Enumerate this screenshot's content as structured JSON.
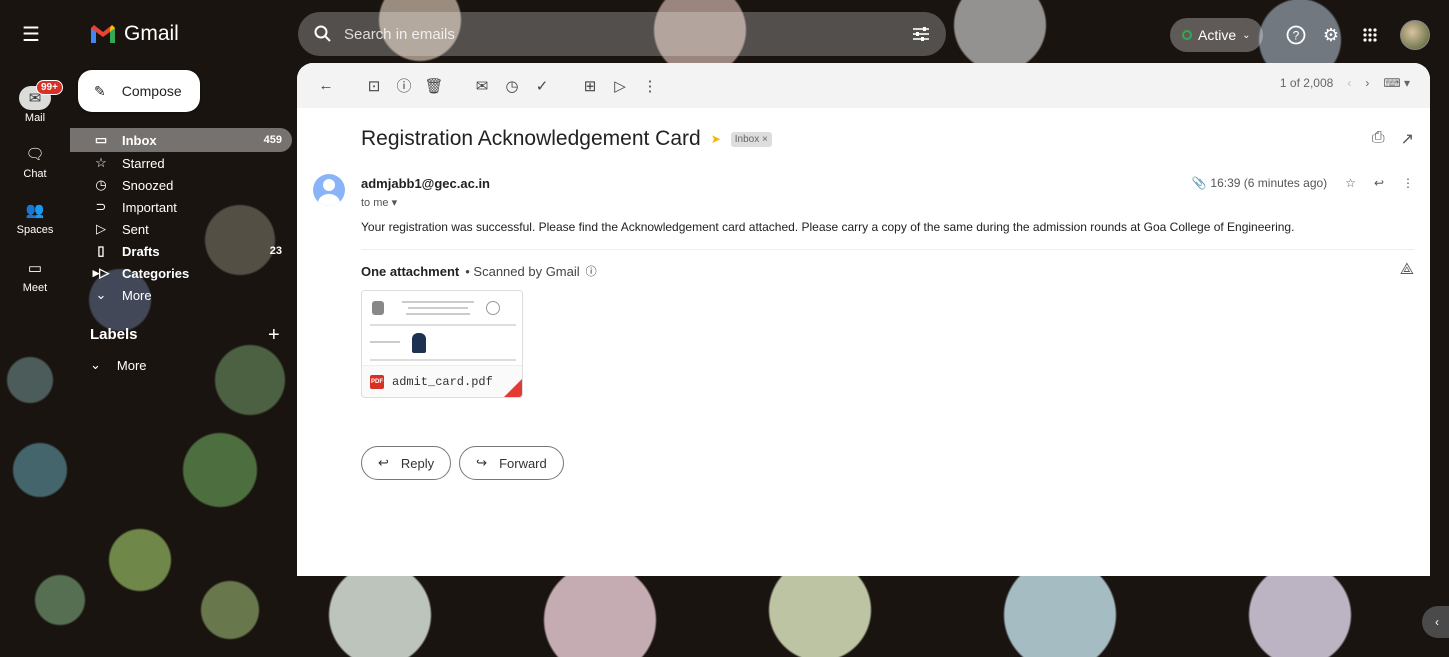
{
  "app": {
    "name": "Gmail"
  },
  "rail": {
    "mail_badge": "99+",
    "items": [
      {
        "label": "Mail",
        "icon": "mail-icon"
      },
      {
        "label": "Chat",
        "icon": "chat-icon"
      },
      {
        "label": "Spaces",
        "icon": "spaces-icon"
      },
      {
        "label": "Meet",
        "icon": "meet-icon"
      }
    ]
  },
  "search": {
    "placeholder": "Search in emails"
  },
  "status": {
    "label": "Active",
    "color": "#34a853"
  },
  "compose": {
    "label": "Compose"
  },
  "nav": [
    {
      "label": "Inbox",
      "count": "459",
      "icon": "inbox-icon"
    },
    {
      "label": "Starred",
      "count": "",
      "icon": "star-icon"
    },
    {
      "label": "Snoozed",
      "count": "",
      "icon": "clock-icon"
    },
    {
      "label": "Important",
      "count": "",
      "icon": "important-icon"
    },
    {
      "label": "Sent",
      "count": "",
      "icon": "send-icon"
    },
    {
      "label": "Drafts",
      "count": "23",
      "icon": "draft-icon"
    },
    {
      "label": "Categories",
      "count": "",
      "icon": "label-icon"
    },
    {
      "label": "More",
      "count": "",
      "icon": "chevron-down-icon"
    }
  ],
  "labels": {
    "title": "Labels",
    "more": "More"
  },
  "toolbar": {
    "pager": "1 of 2,008"
  },
  "email": {
    "subject": "Registration Acknowledgement Card",
    "label_chip": "Inbox ×",
    "sender": "admjabb1@gec.ac.in",
    "to": "to me",
    "time": "16:39 (6 minutes ago)",
    "body": "Your registration was successful. Please find the Acknowledgement card attached. Please carry a copy of the same during the admission rounds at Goa College of Engineering.",
    "attach_count": "One attachment",
    "scanned": "• Scanned by Gmail",
    "attachment_name": "admit_card.pdf",
    "pdf_tag": "PDF"
  },
  "actions": {
    "reply": "Reply",
    "forward": "Forward"
  }
}
